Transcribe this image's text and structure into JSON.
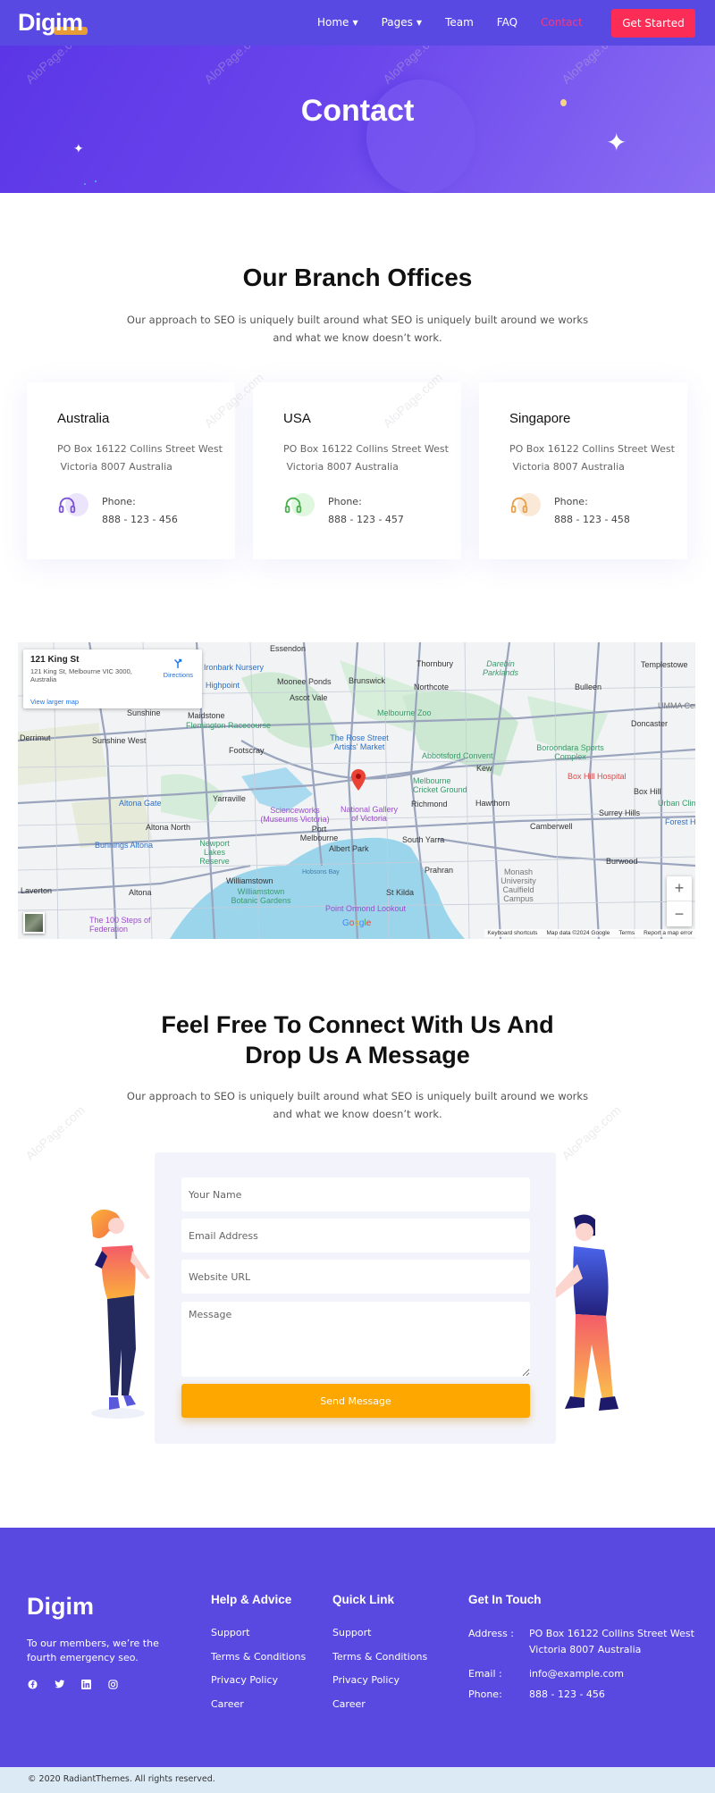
{
  "header": {
    "logo": "Digim",
    "nav": [
      {
        "label": "Home",
        "has_dropdown": true,
        "active": false
      },
      {
        "label": "Pages",
        "has_dropdown": true,
        "active": false
      },
      {
        "label": "Team",
        "has_dropdown": false,
        "active": false
      },
      {
        "label": "FAQ",
        "has_dropdown": false,
        "active": false
      },
      {
        "label": "Contact",
        "has_dropdown": false,
        "active": true
      }
    ],
    "cta_label": "Get Started",
    "colors": {
      "bg": "#5949e3",
      "cta": "#fb2c56",
      "active_link": "#e83e8c",
      "logo_accent": "#f5a623"
    }
  },
  "hero": {
    "title": "Contact"
  },
  "branches": {
    "title": "Our Branch Offices",
    "subtitle_line1": "Our approach to SEO is uniquely built around what SEO is uniquely built around we  works",
    "subtitle_line2": "and what we know doesn’t work.",
    "offices": [
      {
        "name": "Australia",
        "address_line1": "PO Box 16122 Collins Street West",
        "address_line2": " Victoria 8007 Australia",
        "phone_label": "Phone:",
        "phone": "888 - 123 - 456",
        "icon": "headphones-icon",
        "icon_color": "#7b55d6",
        "icon_bg": "#ece4fb"
      },
      {
        "name": "USA",
        "address_line1": "PO Box 16122 Collins Street West",
        "address_line2": " Victoria 8007 Australia",
        "phone_label": "Phone:",
        "phone": "888 - 123 - 457",
        "icon": "headphones-icon",
        "icon_color": "#4caf50",
        "icon_bg": "#dff6df"
      },
      {
        "name": "Singapore",
        "address_line1": "PO Box 16122 Collins Street West",
        "address_line2": " Victoria 8007 Australia",
        "phone_label": "Phone:",
        "phone": "888 - 123 - 458",
        "icon": "headphones-icon",
        "icon_color": "#e8a04a",
        "icon_bg": "#fbe9d8"
      }
    ]
  },
  "map": {
    "place_title": "121 King St",
    "place_address": "121 King St, Melbourne VIC 3000, Australia",
    "view_larger": "View larger map",
    "directions": "Directions",
    "zoom_in": "+",
    "zoom_out": "−",
    "footer_links": [
      "Keyboard shortcuts",
      "Map data ©2024 Google",
      "Terms",
      "Report a map error"
    ],
    "google": "Google",
    "labels": [
      {
        "text": "Essendon",
        "type": "place"
      },
      {
        "text": "Moonee Ponds",
        "type": "place"
      },
      {
        "text": "Brunswick",
        "type": "place"
      },
      {
        "text": "Thornbury",
        "type": "place"
      },
      {
        "text": "Northcote",
        "type": "place"
      },
      {
        "text": "Ascot Vale",
        "type": "place"
      },
      {
        "text": "Sunshine",
        "type": "place"
      },
      {
        "text": "Maidstone",
        "type": "place"
      },
      {
        "text": "Derrimut",
        "type": "place"
      },
      {
        "text": "Sunshine West",
        "type": "place"
      },
      {
        "text": "Footscray",
        "type": "place"
      },
      {
        "text": "Yarraville",
        "type": "place"
      },
      {
        "text": "Altona North",
        "type": "place"
      },
      {
        "text": "Port Melbourne",
        "type": "place"
      },
      {
        "text": "Albert Park",
        "type": "place"
      },
      {
        "text": "South Yarra",
        "type": "place"
      },
      {
        "text": "Williamstown",
        "type": "place"
      },
      {
        "text": "Altona",
        "type": "place"
      },
      {
        "text": "Laverton",
        "type": "place"
      },
      {
        "text": "St Kilda",
        "type": "place"
      },
      {
        "text": "Richmond",
        "type": "place"
      },
      {
        "text": "Kew",
        "type": "place"
      },
      {
        "text": "Hawthorn",
        "type": "place"
      },
      {
        "text": "Camberwell",
        "type": "place"
      },
      {
        "text": "Surrey Hills",
        "type": "place"
      },
      {
        "text": "Box Hill",
        "type": "place"
      },
      {
        "text": "Burwood",
        "type": "place"
      },
      {
        "text": "Bulleen",
        "type": "place"
      },
      {
        "text": "Doncaster",
        "type": "place"
      },
      {
        "text": "Templestowe",
        "type": "place"
      },
      {
        "text": "Prahran",
        "type": "place"
      },
      {
        "text": "Flemington Racecourse",
        "type": "poi-green"
      },
      {
        "text": "Melbourne Zoo",
        "type": "poi-green"
      },
      {
        "text": "Darebin Parklands",
        "type": "poi-green"
      },
      {
        "text": "Boroondara Sports Complex",
        "type": "poi-green"
      },
      {
        "text": "Abbotsford Convent",
        "type": "poi-green"
      },
      {
        "text": "Melbourne Cricket Ground",
        "type": "poi-green"
      },
      {
        "text": "Newport Lakes Reserve",
        "type": "poi-green"
      },
      {
        "text": "Williamstown Botanic Gardens",
        "type": "poi-green"
      },
      {
        "text": "Monash University Caulfield Campus",
        "type": "place-grey"
      },
      {
        "text": "The Rose Street Artists' Market",
        "type": "poi-blue"
      },
      {
        "text": "Altona Gate",
        "type": "poi-blue"
      },
      {
        "text": "Bunnings Altona",
        "type": "poi-blue"
      },
      {
        "text": "Highpoint",
        "type": "poi-blue"
      },
      {
        "text": "Ironbark Nursery",
        "type": "poi-blue"
      },
      {
        "text": "Scienceworks (Museums Victoria)",
        "type": "poi-purple"
      },
      {
        "text": "National Gallery of Victoria",
        "type": "poi-purple"
      },
      {
        "text": "The 100 Steps of Federation",
        "type": "poi-purple"
      },
      {
        "text": "Point Ormond Lookout",
        "type": "poi-purple"
      },
      {
        "text": "Box Hill Hospital",
        "type": "poi-red"
      },
      {
        "text": "UMMA Centre",
        "type": "place-grey"
      },
      {
        "text": "Urban Climb Bl",
        "type": "poi-green"
      },
      {
        "text": "Forest Hill Ch",
        "type": "poi-blue"
      },
      {
        "text": "Hobsons Bay",
        "type": "water"
      }
    ]
  },
  "contact": {
    "title_line1": "Feel Free To Connect With Us And",
    "title_line2": "Drop Us A Message",
    "subtitle_line1": "Our approach to SEO is uniquely built around what SEO is uniquely built around we  works",
    "subtitle_line2": "and what we know doesn’t work.",
    "form": {
      "name_placeholder": "Your Name",
      "email_placeholder": "Email Address",
      "url_placeholder": "Website URL",
      "message_placeholder": "Message",
      "name_value": "",
      "email_value": "",
      "url_value": "",
      "message_value": "",
      "submit_label": "Send Message",
      "submit_color": "#fea700"
    }
  },
  "footer": {
    "logo": "Digim",
    "tagline": "To our members, we’re the fourth emergency seo.",
    "socials": [
      "facebook-icon",
      "twitter-icon",
      "linkedin-icon",
      "instagram-icon"
    ],
    "help": {
      "title": "Help & Advice",
      "links": [
        "Support",
        "Terms & Conditions",
        "Privacy Policy",
        "Career"
      ]
    },
    "quick": {
      "title": "Quick Link",
      "links": [
        "Support",
        "Terms & Conditions",
        "Privacy Policy",
        "Career"
      ]
    },
    "touch": {
      "title": "Get In Touch",
      "address_label": "Address :",
      "address_line1": "PO Box 16122 Collins Street West",
      "address_line2": "Victoria 8007 Australia",
      "email_label": "Email :",
      "email": "info@example.com",
      "phone_label": "Phone:",
      "phone": "888 - 123 - 456"
    },
    "bg": "#5949e0",
    "copyright": "© 2020 RadiantThemes. All rights reserved."
  },
  "watermark": "AloPage.com"
}
